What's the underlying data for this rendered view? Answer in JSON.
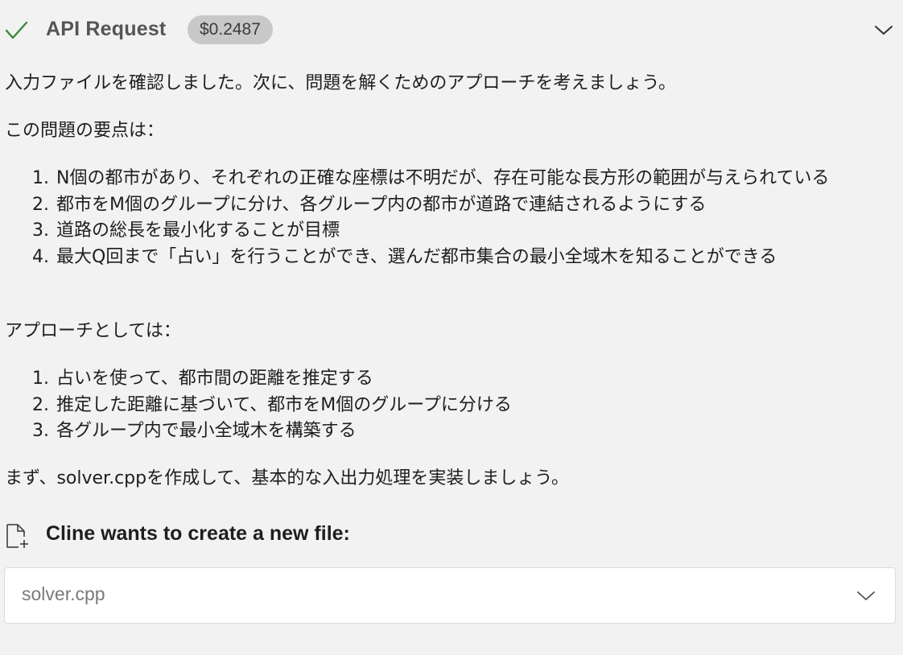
{
  "api_request": {
    "title": "API Request",
    "cost": "$0.2487",
    "status_icon": "check-icon",
    "expand_icon": "chevron-down-icon",
    "status_color": "#3a8a3a"
  },
  "message": {
    "intro": "入力ファイルを確認しました。次に、問題を解くためのアプローチを考えましょう。",
    "points_heading": "この問題の要点は：",
    "points": [
      {
        "num": "1.",
        "text": "N個の都市があり、それぞれの正確な座標は不明だが、存在可能な長方形の範囲が与えられている"
      },
      {
        "num": "2.",
        "text": "都市をM個のグループに分け、各グループ内の都市が道路で連結されるようにする"
      },
      {
        "num": "3.",
        "text": "道路の総長を最小化することが目標"
      },
      {
        "num": "4.",
        "text": "最大Q回まで「占い」を行うことができ、選んだ都市集合の最小全域木を知ることができる"
      }
    ],
    "approach_heading": "アプローチとしては：",
    "approach": [
      {
        "num": "1.",
        "text": "占いを使って、都市間の距離を推定する"
      },
      {
        "num": "2.",
        "text": "推定した距離に基づいて、都市をM個のグループに分ける"
      },
      {
        "num": "3.",
        "text": "各グループ内で最小全域木を構築する"
      }
    ],
    "first_step": "まず、solver.cppを作成して、基本的な入出力処理を実装しましょう。"
  },
  "create_file": {
    "label": "Cline wants to create a new file:",
    "icon": "file-plus-icon",
    "filename": "solver.cpp",
    "expand_icon": "chevron-down-icon"
  }
}
